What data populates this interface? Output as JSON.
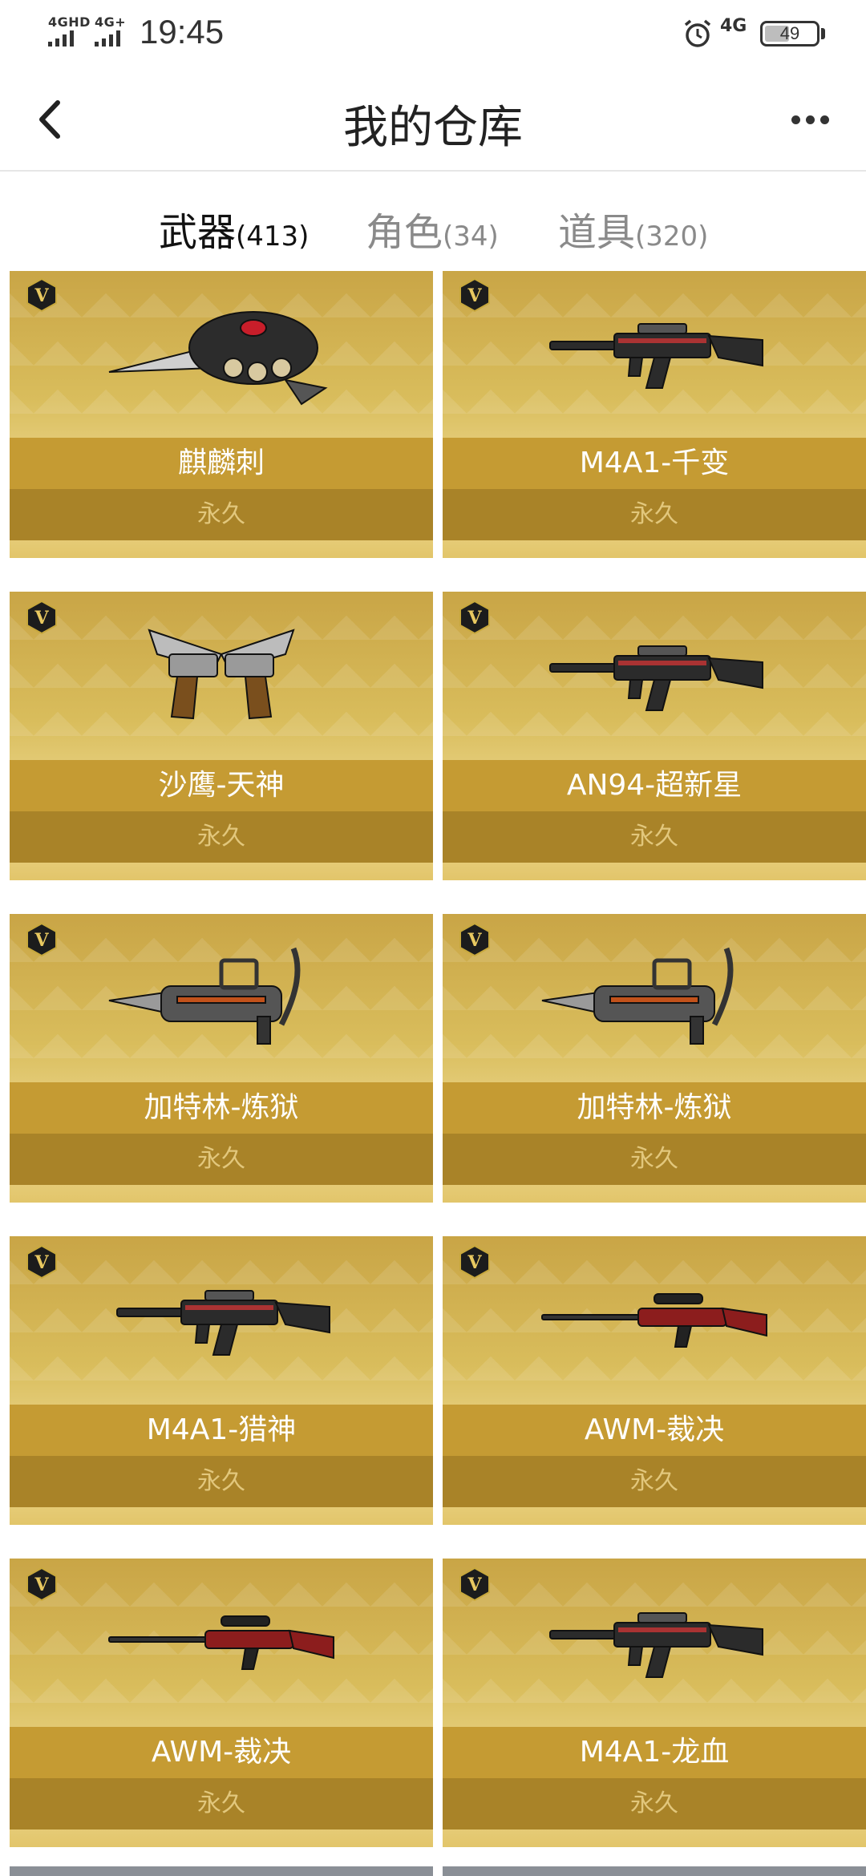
{
  "status_bar": {
    "network_1": "4GHD",
    "network_2": "4G+",
    "time": "19:45",
    "network_right": "4G",
    "battery": "49",
    "battery_level": 0.49
  },
  "nav": {
    "title": "我的仓库"
  },
  "tabs": [
    {
      "label": "武器",
      "count": "(413)",
      "active": true
    },
    {
      "label": "角色",
      "count": "(34)",
      "active": false
    },
    {
      "label": "道具",
      "count": "(320)",
      "active": false
    }
  ],
  "colors": {
    "card_gold": "#d9bd5c",
    "name_band": "#c59b33",
    "permanent_band": "#a98328",
    "badge": "#1c1c1c"
  },
  "items": [
    {
      "name": "麒麟刺",
      "duration": "永久",
      "icon": "knuckle-knife-icon"
    },
    {
      "name": "M4A1-千变",
      "duration": "永久",
      "icon": "rifle-icon"
    },
    {
      "name": "沙鹰-天神",
      "duration": "永久",
      "icon": "dual-pistol-icon"
    },
    {
      "name": "AN94-超新星",
      "duration": "永久",
      "icon": "rifle-icon"
    },
    {
      "name": "加特林-炼狱",
      "duration": "永久",
      "icon": "gatling-gun-icon"
    },
    {
      "name": "加特林-炼狱",
      "duration": "永久",
      "icon": "gatling-gun-icon"
    },
    {
      "name": "M4A1-猎神",
      "duration": "永久",
      "icon": "rifle-icon"
    },
    {
      "name": "AWM-裁决",
      "duration": "永久",
      "icon": "sniper-rifle-icon"
    },
    {
      "name": "AWM-裁决",
      "duration": "永久",
      "icon": "sniper-rifle-icon"
    },
    {
      "name": "M4A1-龙血",
      "duration": "永久",
      "icon": "rifle-icon"
    }
  ]
}
